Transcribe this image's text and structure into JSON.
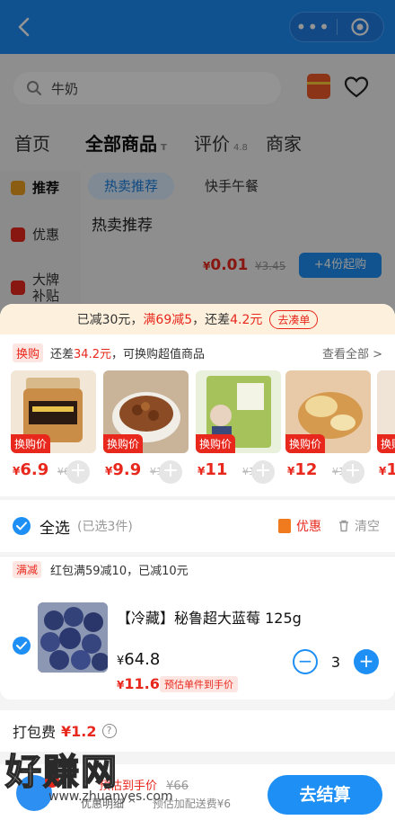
{
  "topbar": {
    "more_icon": "more-dots-icon",
    "close_icon": "target-circle-icon"
  },
  "search": {
    "placeholder": "牛奶"
  },
  "nav_tabs": [
    {
      "label": "首页"
    },
    {
      "label": "全部商品",
      "badge": "T"
    },
    {
      "label": "评价",
      "badge": "4.8"
    },
    {
      "label": "商家"
    }
  ],
  "left_nav": [
    {
      "label": "推荐"
    },
    {
      "label": "优惠"
    },
    {
      "label": "大牌\n补贴"
    }
  ],
  "sub_tabs": [
    "热卖推荐",
    "快手午餐"
  ],
  "section_title": "热卖推荐",
  "bg_product": {
    "currency": "¥",
    "price": "0.01",
    "orig": "¥3.45",
    "btn": "+4份起购"
  },
  "promo_bar": {
    "prefix": "已减30元，",
    "highlight": "满69减5",
    "mid": "，还差",
    "amount": "4.2元",
    "cta": "去凑单"
  },
  "swap": {
    "tag": "换购",
    "text_prefix": "还差",
    "amount": "34.2元",
    "text_suffix": "，可换购超值商品",
    "see_all": "查看全部 >",
    "item_label": "换购价",
    "items": [
      {
        "currency": "¥",
        "price": "6.9",
        "orig": "¥6"
      },
      {
        "currency": "¥",
        "price": "9.9",
        "orig": "¥1"
      },
      {
        "currency": "¥",
        "price": "11",
        "orig": "¥1"
      },
      {
        "currency": "¥",
        "price": "12",
        "orig": "¥1"
      },
      {
        "currency": "¥",
        "price": "1",
        "orig": ""
      }
    ]
  },
  "select_all": {
    "label": "全选",
    "count": "(已选3件)",
    "discount": "优惠",
    "clear": "清空"
  },
  "full_reduction": {
    "tag": "满减",
    "text": "红包满59减10，已减10元"
  },
  "product": {
    "name": "【冷藏】秘鲁超大蓝莓 125g",
    "currency": "¥",
    "price": "64.8",
    "hand_currency": "¥",
    "hand_price": "11.6",
    "hand_tag": "预估单件到手价",
    "qty": "3"
  },
  "packing": {
    "label": "打包费",
    "fee": "¥1.2",
    "help": "?"
  },
  "checkout": {
    "est_label": "预估到手价",
    "est_orig": "¥66",
    "detail": "优惠明细 ^",
    "delivery": "预估加配送费¥6",
    "pay_btn": "去结算"
  },
  "watermark": {
    "big": "好赚网",
    "small": "www.zhuanyes.com"
  },
  "colors": {
    "brand_blue": "#1e8ff4",
    "price_red": "#e8281d",
    "promo_bg": "#fdf1dd"
  }
}
